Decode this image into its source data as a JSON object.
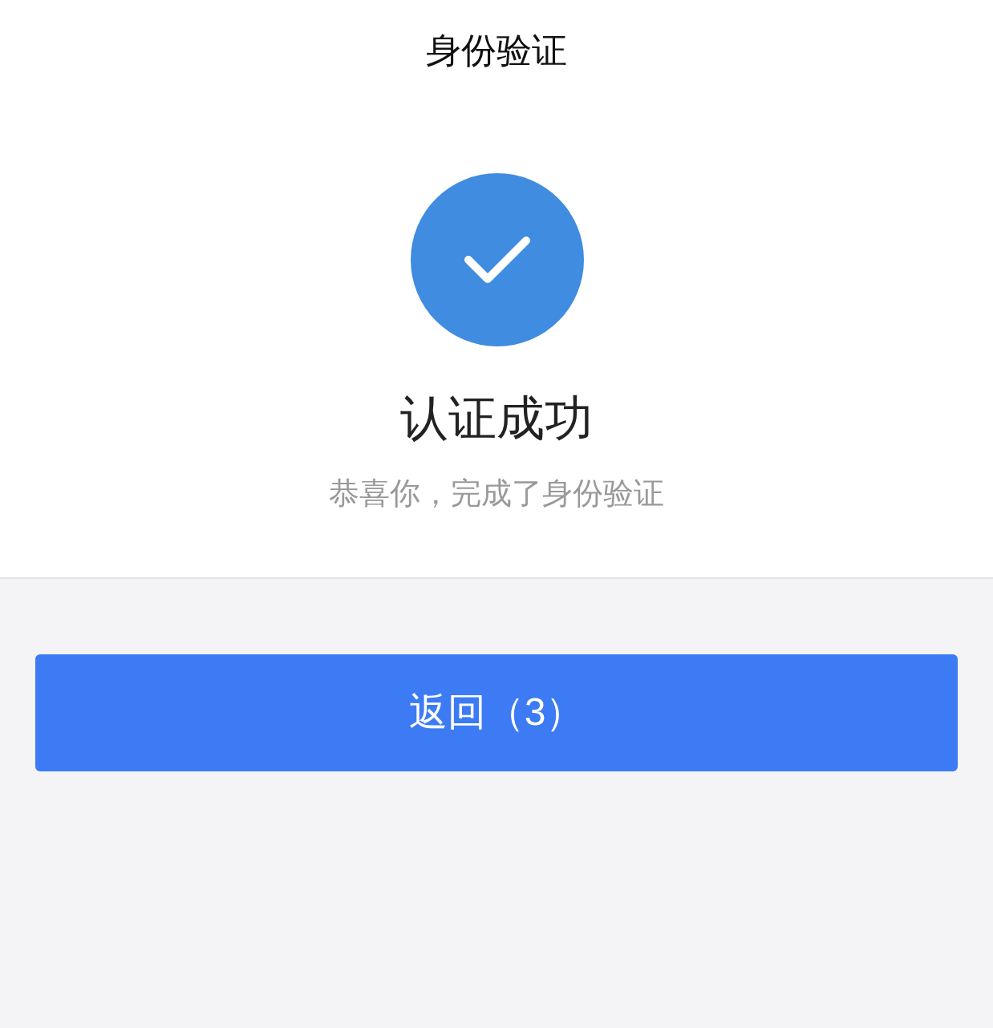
{
  "header": {
    "title": "身份验证"
  },
  "result": {
    "success": true,
    "title": "认证成功",
    "message": "恭喜你，完成了身份验证"
  },
  "button": {
    "label": "返回（3）"
  }
}
